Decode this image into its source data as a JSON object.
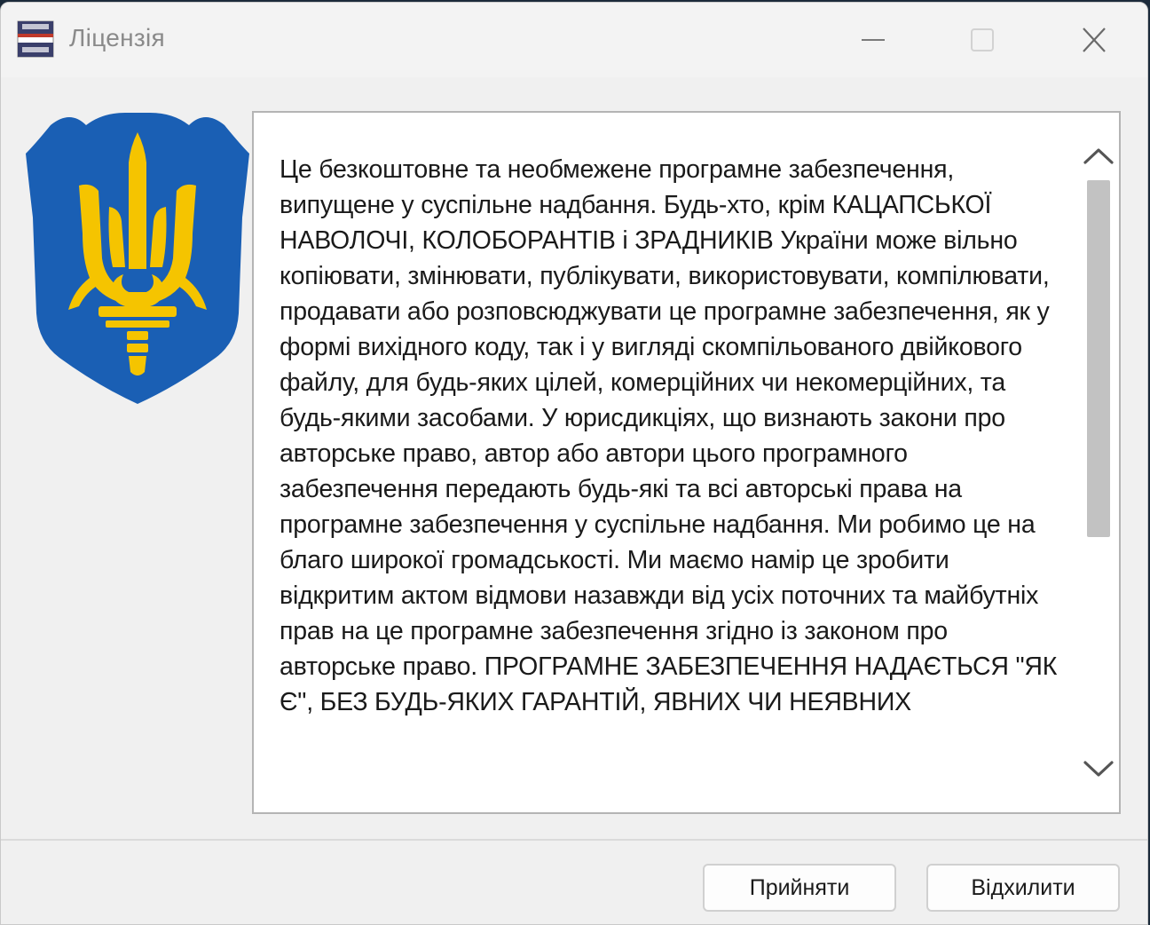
{
  "window": {
    "title": "Ліцензія"
  },
  "license": {
    "text": "Це безкоштовне та необмежене програмне забезпечення, випущене у суспільне надбання. Будь-хто, крім  КАЦАПСЬКОЇ НАВОЛОЧІ, КОЛОБОРАНТІВ  і ЗРАДНИКІВ України може вільно копіювати, змінювати, публікувати, використовувати, компілювати, продавати або розповсюджувати це програмне забезпечення, як у формі вихідного коду, так і у вигляді скомпільованого двійкового файлу, для будь-яких цілей, комерційних чи некомерційних, та будь-якими засобами. У юрисдикціях, що визнають закони про авторське право, автор або автори цього програмного забезпечення передають будь-які та всі авторські права на програмне забезпечення у суспільне надбання. Ми робимо це на благо широкої громадськості. Ми маємо намір це зробити відкритим актом відмови назавжди від усіх поточних та майбутніх прав на це програмне забезпечення згідно із законом про авторське право. ПРОГРАМНЕ ЗАБЕЗПЕЧЕННЯ НАДАЄТЬСЯ \"ЯК Є\", БЕЗ БУДЬ-ЯКИХ ГАРАНТІЙ, ЯВНИХ ЧИ НЕЯВНИХ"
  },
  "buttons": {
    "accept": "Прийняти",
    "decline": "Відхилити"
  },
  "icons": {
    "app": "app-icon",
    "minimize": "minimize-icon",
    "maximize": "maximize-icon",
    "close": "close-icon",
    "emblem": "trident-emblem",
    "scroll_up": "chevron-up-icon",
    "scroll_down": "chevron-down-icon"
  },
  "colors": {
    "shield_blue": "#1a5fb4",
    "trident_yellow": "#f5c400"
  }
}
